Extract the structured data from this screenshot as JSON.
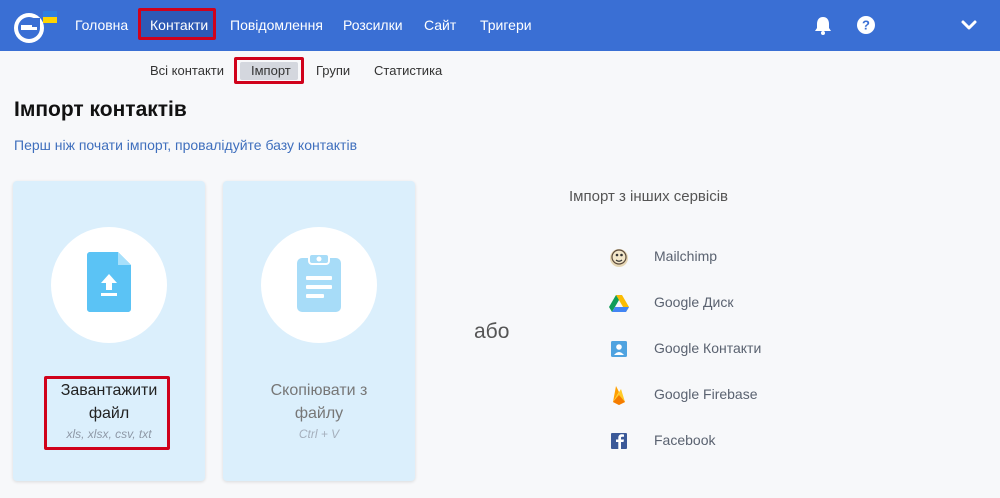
{
  "nav": {
    "items": [
      "Головна",
      "Контакти",
      "Повідомлення",
      "Розсилки",
      "Сайт",
      "Тригери"
    ],
    "active": "Контакти"
  },
  "subnav": {
    "items": [
      "Всі контакти",
      "Імпорт",
      "Групи",
      "Статистика"
    ],
    "active": "Імпорт"
  },
  "page": {
    "title": "Імпорт контактів",
    "hint": "Перш ніж почати імпорт, провалідуйте базу контактів"
  },
  "upload_card": {
    "title_line1": "Завантажити",
    "title_line2": "файл",
    "subtitle": "xls, xlsx, csv, txt"
  },
  "paste_card": {
    "title_line1": "Скопіювати з",
    "title_line2": "файлу",
    "subtitle": "Ctrl + V"
  },
  "or_label": "або",
  "services": {
    "title": "Імпорт з інших сервісів",
    "items": [
      {
        "label": "Mailchimp",
        "icon": "mailchimp-icon"
      },
      {
        "label": "Google Диск",
        "icon": "google-drive-icon"
      },
      {
        "label": "Google Контакти",
        "icon": "google-contacts-icon"
      },
      {
        "label": "Google Firebase",
        "icon": "firebase-icon"
      },
      {
        "label": "Facebook",
        "icon": "facebook-icon"
      }
    ]
  },
  "colors": {
    "topbar": "#3a6fd4",
    "highlight": "#d0021b",
    "card_bg": "#dbeffc",
    "link": "#3f6fbd"
  }
}
